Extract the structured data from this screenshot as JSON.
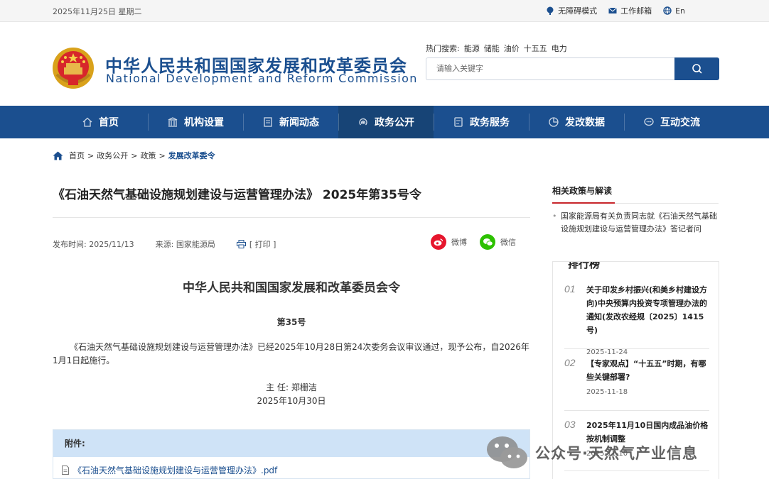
{
  "topbar": {
    "date": "2025年11月25日 星期二",
    "links": [
      {
        "label": "无障碍模式",
        "icon": "accessibility-icon"
      },
      {
        "label": "工作邮箱",
        "icon": "mail-icon"
      },
      {
        "label": "En",
        "icon": "globe-icon"
      }
    ]
  },
  "header": {
    "cn_title": "中华人民共和国国家发展和改革委员会",
    "en_title": "National Development and Reform Commission",
    "hot_label": "热门搜索:",
    "hot_terms": [
      "能源",
      "储能",
      "油价",
      "十五五",
      "电力"
    ],
    "search_placeholder": "请输入关键字",
    "search_icon": "search-icon"
  },
  "nav": {
    "items": [
      {
        "label": "首页",
        "icon": "home-icon"
      },
      {
        "label": "机构设置",
        "icon": "building-icon"
      },
      {
        "label": "新闻动态",
        "icon": "news-icon"
      },
      {
        "label": "政务公开",
        "icon": "broadcast-icon"
      },
      {
        "label": "政务服务",
        "icon": "service-icon"
      },
      {
        "label": "发改数据",
        "icon": "pie-chart-icon"
      },
      {
        "label": "互动交流",
        "icon": "chat-icon"
      }
    ],
    "active_index": 3,
    "color": "#1b4f8f"
  },
  "breadcrumb": {
    "items": [
      "首页",
      "政务公开",
      "政策",
      "发展改革委令"
    ]
  },
  "article": {
    "title": "《石油天然气基础设施规划建设与运营管理办法》 2025年第35号令",
    "publish_label": "发布时间:",
    "publish_date": "2025/11/13",
    "source_label": "来源:",
    "source": "国家能源局",
    "print_label": "[ 打印 ]",
    "share": [
      {
        "label": "微博",
        "icon": "weibo-icon",
        "color": "#e6162d"
      },
      {
        "label": "微信",
        "icon": "wechat-icon",
        "color": "#2dc100"
      }
    ],
    "doc_heading": "中华人民共和国国家发展和改革委员会令",
    "doc_number": "第35号",
    "doc_body": "《石油天然气基础设施规划建设与运营管理办法》已经2025年10月28日第24次委务会议审议通过，现予公布，自2026年1月1日起施行。",
    "signatory": "主 任: 郑栅洁",
    "sign_date": "2025年10月30日",
    "attachment_label": "附件:",
    "attachment_file": "《石油天然气基础设施规划建设与运营管理办法》.pdf"
  },
  "sidebar": {
    "related_title": "相关政策与解读",
    "related_links": [
      "国家能源局有关负责同志就《石油天然气基础设施规划建设与运营管理办法》答记者问"
    ],
    "rank_title": "排行榜",
    "rank_items": [
      {
        "num": "01",
        "title": "关于印发乡村振兴(和美乡村建设方向)中央预算内投资专项管理办法的通知(发改农经规〔2025〕1415号)",
        "date": "2025-11-24"
      },
      {
        "num": "02",
        "title": "【专家观点】“十五五”时期，有哪些关键部署?",
        "date": "2025-11-18"
      },
      {
        "num": "03",
        "title": "2025年11月10日国内成品油价格按机制调整",
        "date": "2025-11-10"
      }
    ]
  },
  "watermark": {
    "text": "公众号·天然气产业信息",
    "icon": "wechat-icon"
  }
}
